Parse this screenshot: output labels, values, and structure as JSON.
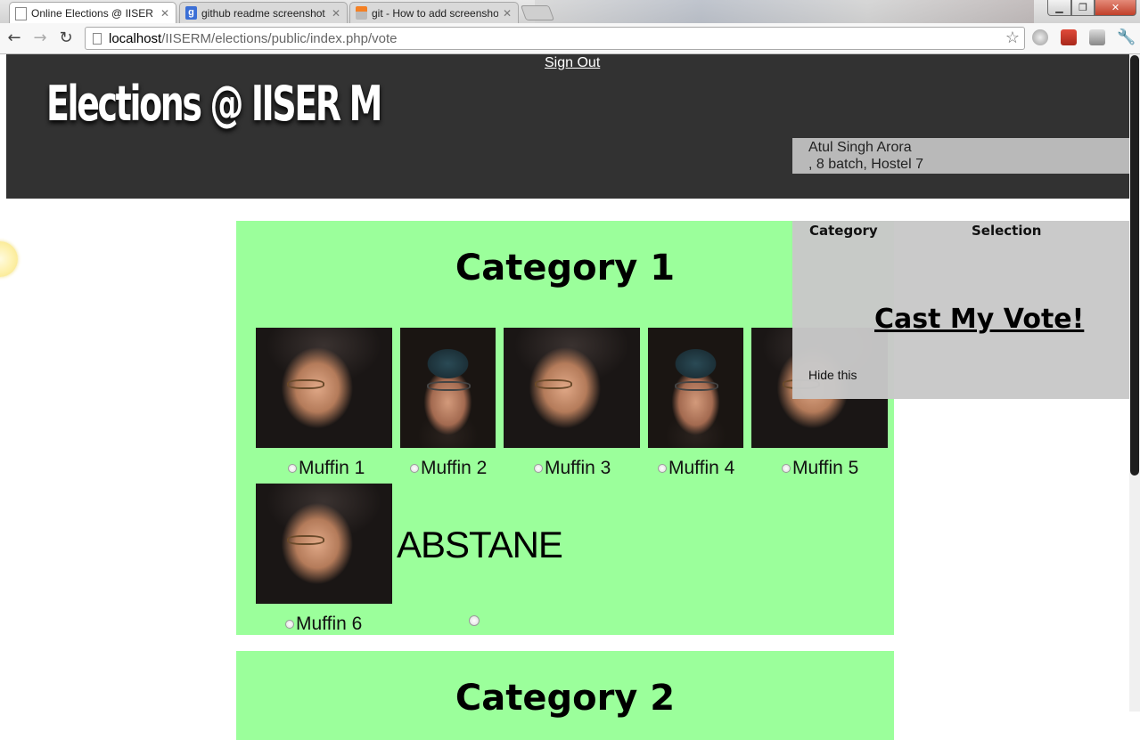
{
  "browser": {
    "tabs": [
      {
        "title": "Online Elections @ IISER M",
        "icon": "page-icon",
        "active": true
      },
      {
        "title": "github readme screenshot",
        "icon": "google-icon",
        "active": false
      },
      {
        "title": "git - How to add screensho",
        "icon": "stackoverflow-icon",
        "active": false
      }
    ],
    "address": {
      "host": "localhost",
      "path": "/IISERM/elections/public/index.php/vote"
    }
  },
  "header": {
    "title": "Elections @ IISER M",
    "sign_out": "Sign Out",
    "user_name": "Atul Singh Arora",
    "user_details": ", 8 batch, Hostel 7"
  },
  "categories": [
    {
      "title": "Category 1",
      "candidates": [
        {
          "name": "Muffin 1",
          "photo": "photo-a"
        },
        {
          "name": "Muffin 2",
          "photo": "photo-b"
        },
        {
          "name": "Muffin 3",
          "photo": "photo-a"
        },
        {
          "name": "Muffin 4",
          "photo": "photo-b"
        },
        {
          "name": "Muffin 5",
          "photo": "photo-a"
        },
        {
          "name": "Muffin 6",
          "photo": "photo-a"
        }
      ],
      "abstain_label": "ABSTANE"
    },
    {
      "title": "Category 2"
    }
  ],
  "vote_panel": {
    "col_category": "Category",
    "col_selection": "Selection",
    "cast_vote": "Cast My Vote!",
    "hide": "Hide this"
  },
  "colors": {
    "header_bg": "#323232",
    "category_bg": "#9bff9b",
    "panel_bg": "#c8c8c8"
  }
}
